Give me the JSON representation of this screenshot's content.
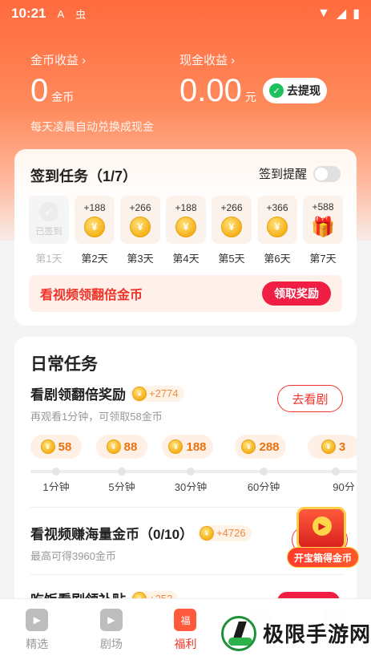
{
  "status_bar": {
    "time": "10:21",
    "icon_a": "A",
    "icon_b": "虫"
  },
  "earnings": {
    "coin": {
      "label": "金币收益 ›",
      "value": "0",
      "unit": "金币"
    },
    "cash": {
      "label": "现金收益 ›",
      "value": "0.00",
      "unit": "元"
    },
    "withdraw_label": "去提现",
    "note": "每天凌晨自动兑换成现金"
  },
  "signin": {
    "title": "签到任务（1/7）",
    "reminder_label": "签到提醒",
    "days": [
      {
        "amount": "",
        "status": "已签到",
        "label": "第1天"
      },
      {
        "amount": "+188",
        "label": "第2天"
      },
      {
        "amount": "+266",
        "label": "第3天"
      },
      {
        "amount": "+188",
        "label": "第4天"
      },
      {
        "amount": "+266",
        "label": "第5天"
      },
      {
        "amount": "+366",
        "label": "第6天"
      },
      {
        "amount": "+588",
        "label": "第7天"
      }
    ],
    "banner_text": "看视频领翻倍金币",
    "claim_label": "领取奖励"
  },
  "daily": {
    "title": "日常任务",
    "task1": {
      "name": "看剧领翻倍奖励",
      "reward": "+2774",
      "sub": "再观看1分钟，可领取58金币",
      "button": "去看剧"
    },
    "milestones": [
      {
        "coins": "58",
        "label": "1分钟"
      },
      {
        "coins": "88",
        "label": "5分钟"
      },
      {
        "coins": "188",
        "label": "30分钟"
      },
      {
        "coins": "288",
        "label": "60分钟"
      },
      {
        "coins": "3",
        "label": "90分"
      }
    ],
    "task2": {
      "name": "看视频赚海量金币（0/10）",
      "reward": "+4726",
      "sub": "最高可得3960金币",
      "button": "去"
    },
    "task3": {
      "name": "吃饭看剧领补贴",
      "reward": "+252"
    }
  },
  "chest": {
    "label": "开宝箱得金币"
  },
  "tabs": [
    {
      "label": "精选",
      "icon": "play-icon"
    },
    {
      "label": "剧场",
      "icon": "tv-icon"
    },
    {
      "label": "福利",
      "icon": "gift-icon"
    },
    {
      "label": "",
      "icon": "hat-icon"
    },
    {
      "label": "",
      "icon": "profile-icon"
    }
  ],
  "watermark": {
    "text": "极限手游网"
  },
  "colors": {
    "accent": "#f0342a",
    "header": "#ff6a3d",
    "coin": "#f6b21a"
  }
}
